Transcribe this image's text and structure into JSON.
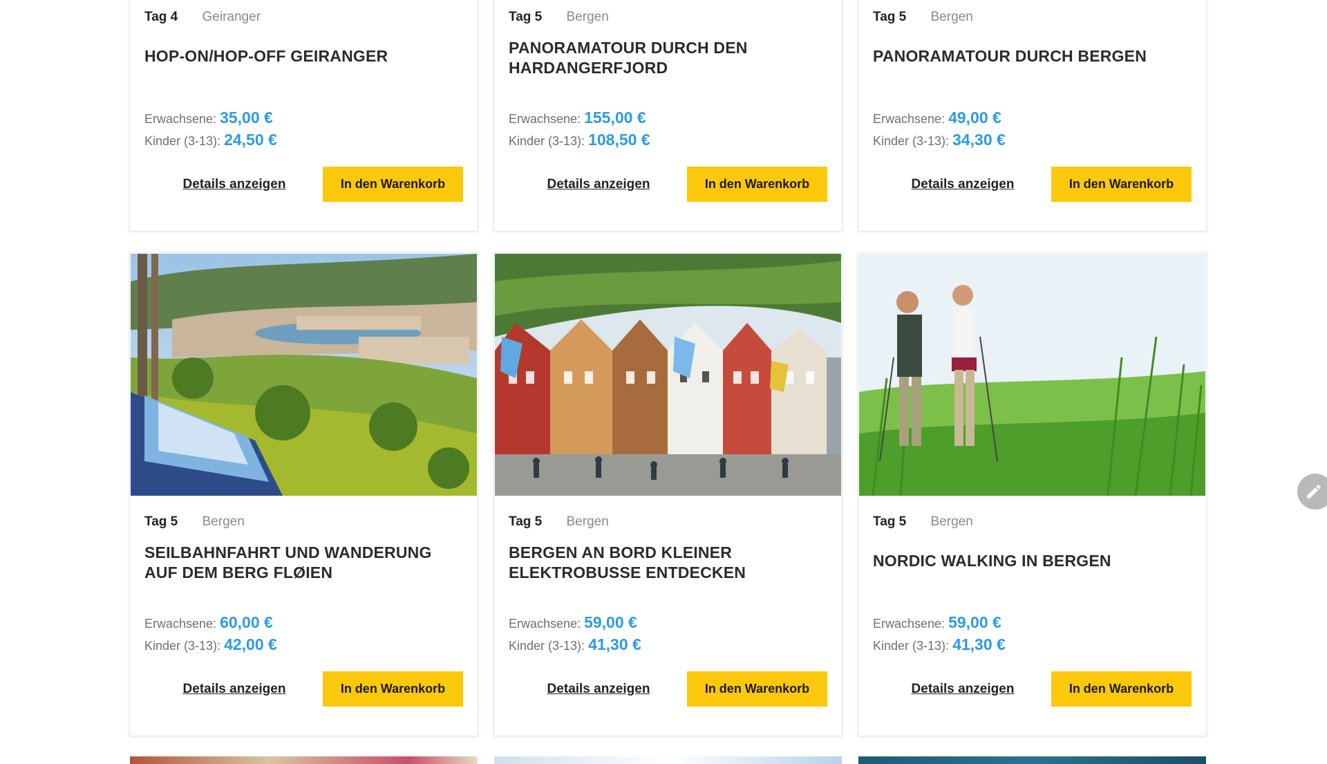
{
  "labels": {
    "adult": "Erwachsene:",
    "child": "Kinder (3-13):",
    "details": "Details anzeigen",
    "cart": "In den Warenkorb"
  },
  "cards": [
    {
      "day": "Tag 4",
      "location": "Geiranger",
      "title": "HOP-ON/HOP-OFF GEIRANGER",
      "adult_price": "35,00 €",
      "child_price": "24,50 €"
    },
    {
      "day": "Tag 5",
      "location": "Bergen",
      "title": "PANORAMATOUR DURCH DEN HARDANGERFJORD",
      "adult_price": "155,00 €",
      "child_price": "108,50 €"
    },
    {
      "day": "Tag 5",
      "location": "Bergen",
      "title": "PANORAMATOUR DURCH BERGEN",
      "adult_price": "49,00 €",
      "child_price": "34,30 €"
    },
    {
      "day": "Tag 5",
      "location": "Bergen",
      "title": "SEILBAHNFAHRT UND WANDERUNG AUF DEM BERG FLØIEN",
      "adult_price": "60,00 €",
      "child_price": "42,00 €"
    },
    {
      "day": "Tag 5",
      "location": "Bergen",
      "title": "BERGEN AN BORD KLEINER ELEKTROBUSSE ENTDECKEN",
      "adult_price": "59,00 €",
      "child_price": "41,30 €"
    },
    {
      "day": "Tag 5",
      "location": "Bergen",
      "title": "NORDIC WALKING IN BERGEN",
      "adult_price": "59,00 €",
      "child_price": "41,30 €"
    }
  ],
  "colors": {
    "price": "#2d9be3",
    "cart_button": "#fcc80c"
  },
  "icons": {
    "edit_fab": "pencil-icon"
  }
}
